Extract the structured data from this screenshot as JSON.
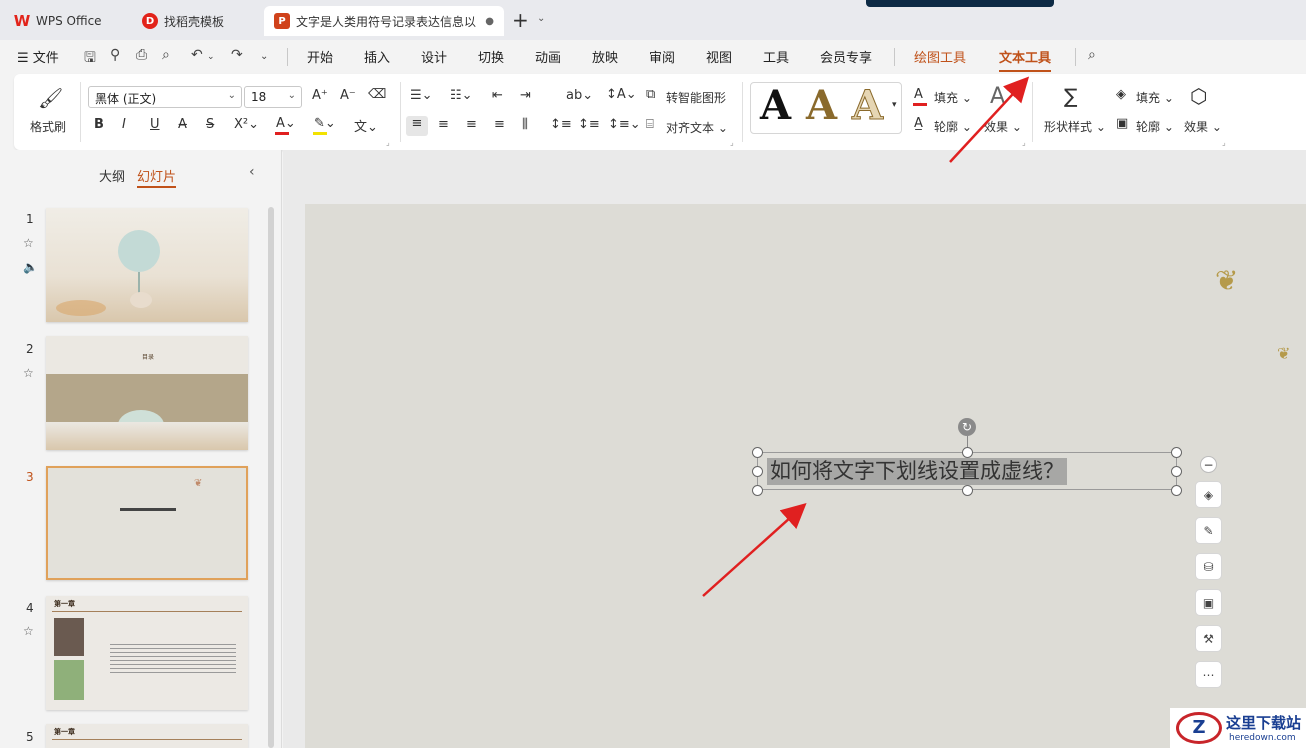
{
  "tabs": {
    "wps": "WPS Office",
    "template": "找稻壳模板",
    "doc": "文字是人类用符号记录表达信息以"
  },
  "menubar": {
    "file": "文件",
    "items": [
      "开始",
      "插入",
      "设计",
      "切换",
      "动画",
      "放映",
      "审阅",
      "视图",
      "工具",
      "会员专享",
      "绘图工具",
      "文本工具"
    ]
  },
  "ribbon": {
    "format_brush": "格式刷",
    "font_name": "黑体 (正文)",
    "font_size": "18",
    "smart_shape": "转智能图形",
    "align_text": "对齐文本",
    "fill": "填充",
    "outline": "轮廓",
    "effect": "效果",
    "shape_style": "形状样式",
    "fill2": "填充",
    "outline2": "轮廓",
    "effect2": "效果",
    "text_style_letter": "A"
  },
  "left_panel": {
    "tab_outline": "大纲",
    "tab_slides": "幻灯片",
    "slides": [
      "1",
      "2",
      "3",
      "4",
      "5"
    ],
    "slide2_title": "目录",
    "slide4_title": "第一章",
    "slide5_title": "第一章"
  },
  "canvas": {
    "textbox_text": "如何将文字下划线设置成虚线？"
  },
  "watermark": {
    "title": "这里下载站",
    "subtitle": "heredown.com"
  },
  "colors": {
    "accent": "#c0521a",
    "arrow": "#e02020",
    "font_color_bar": "#e02020",
    "highlight_bar": "#f2e200"
  }
}
